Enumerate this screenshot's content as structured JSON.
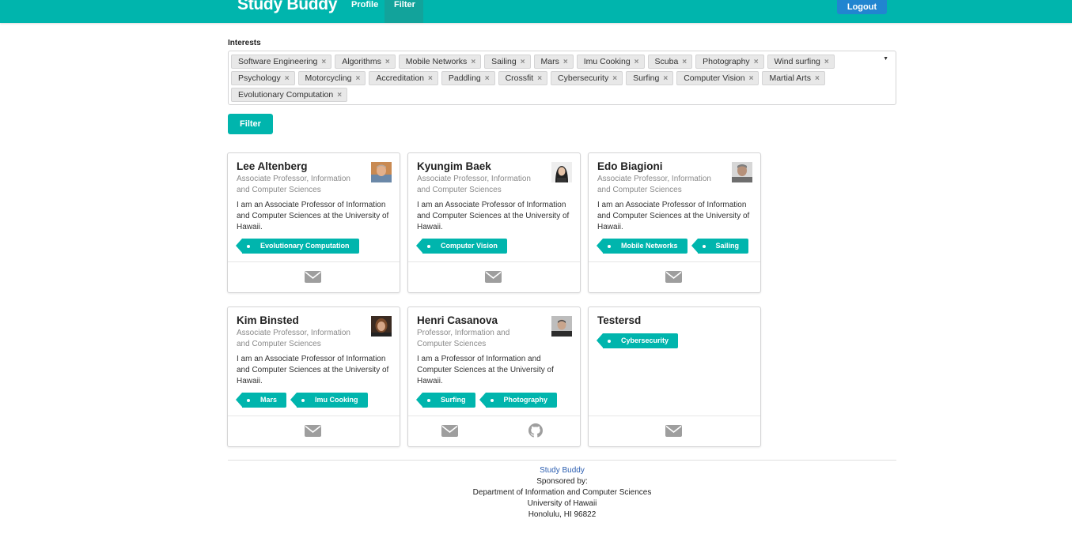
{
  "nav": {
    "brand": "Study Buddy",
    "profile": "Profile",
    "filter": "Filter",
    "logout": "Logout"
  },
  "interests": {
    "label": "Interests",
    "selected": [
      "Software Engineering",
      "Algorithms",
      "Mobile Networks",
      "Sailing",
      "Mars",
      "Imu Cooking",
      "Scuba",
      "Photography",
      "Wind surfing",
      "Psychology",
      "Motorcycling",
      "Accreditation",
      "Paddling",
      "Crossfit",
      "Cybersecurity",
      "Surfing",
      "Computer Vision",
      "Martial Arts",
      "Evolutionary Computation"
    ],
    "remove_glyph": "×",
    "caret_glyph": "▼"
  },
  "filter_button": "Filter",
  "profiles": [
    {
      "name": "Lee Altenberg",
      "title": "Associate Professor, Information and Computer Sciences",
      "description": "I am an Associate Professor of Information and Computer Sciences at the University of Hawaii.",
      "interests": [
        "Evolutionary Computation"
      ],
      "has_avatar": true,
      "has_github": false
    },
    {
      "name": "Kyungim Baek",
      "title": "Associate Professor, Information and Computer Sciences",
      "description": "I am an Associate Professor of Information and Computer Sciences at the University of Hawaii.",
      "interests": [
        "Computer Vision"
      ],
      "has_avatar": true,
      "has_github": false
    },
    {
      "name": "Edo Biagioni",
      "title": "Associate Professor, Information and Computer Sciences",
      "description": "I am an Associate Professor of Information and Computer Sciences at the University of Hawaii.",
      "interests": [
        "Mobile Networks",
        "Sailing"
      ],
      "has_avatar": true,
      "has_github": false
    },
    {
      "name": "Kim Binsted",
      "title": "Associate Professor, Information and Computer Sciences",
      "description": "I am an Associate Professor of Information and Computer Sciences at the University of Hawaii.",
      "interests": [
        "Mars",
        "Imu Cooking"
      ],
      "has_avatar": true,
      "has_github": false
    },
    {
      "name": "Henri Casanova",
      "title": "Professor, Information and Computer Sciences",
      "description": "I am a Professor of Information and Computer Sciences at the University of Hawaii.",
      "interests": [
        "Surfing",
        "Photography"
      ],
      "has_avatar": true,
      "has_github": true
    },
    {
      "name": "Testersd",
      "title": "",
      "description": "",
      "interests": [
        "Cybersecurity"
      ],
      "has_avatar": false,
      "has_github": false
    }
  ],
  "footer": {
    "link": "Study Buddy",
    "line1": "Sponsored by:",
    "line2": "Department of Information and Computer Sciences",
    "line3": "University of Hawaii",
    "line4": "Honolulu, HI 96822"
  },
  "colors": {
    "primary": "#00b5ad",
    "nav_active": "#12a39b",
    "logout": "#2185d0",
    "footer_link": "#2a5db0"
  }
}
